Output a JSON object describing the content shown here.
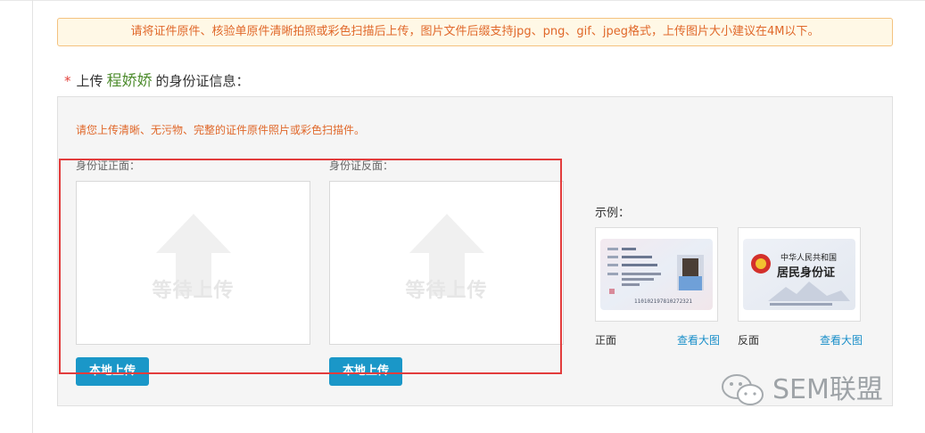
{
  "notice": {
    "text": "请将证件原件、核验单原件清晰拍照或彩色扫描后上传，图片文件后缀支持jpg、png、gif、jpeg格式，上传图片大小建议在4M以下。"
  },
  "upload_title": {
    "required_mark": "*",
    "prefix": "上传",
    "person_name": "程娇娇",
    "suffix": "的身份证信息："
  },
  "panel": {
    "note": "请您上传清晰、无污物、完整的证件原件照片或彩色扫描件。",
    "front": {
      "label": "身份证正面：",
      "placeholder": "等待上传",
      "button": "本地上传"
    },
    "back": {
      "label": "身份证反面：",
      "placeholder": "等待上传",
      "button": "本地上传"
    },
    "example": {
      "label": "示例：",
      "front_caption": "正面",
      "back_caption": "反面",
      "view_large": "查看大图",
      "card_front": {
        "number": "110102197810272321"
      },
      "card_back": {
        "line1": "中华人民共和国",
        "line2": "居民身份证"
      }
    }
  },
  "watermark": {
    "text": "SEM联盟"
  },
  "colors": {
    "accent_blue": "#1a97c8",
    "warning_orange": "#e0682a",
    "name_green": "#4f8d2f",
    "highlight_red": "#e23c3c"
  }
}
